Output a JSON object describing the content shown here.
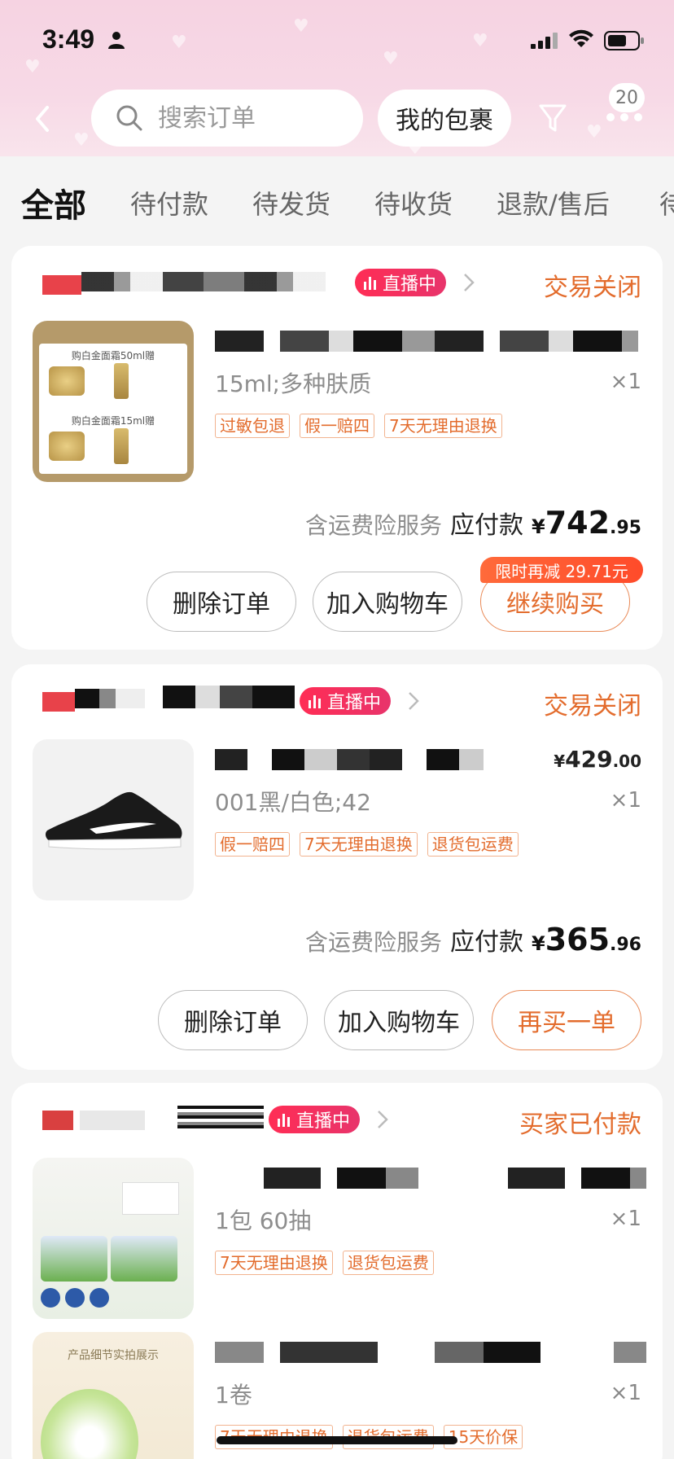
{
  "status_bar": {
    "time": "3:49"
  },
  "nav": {
    "search_placeholder": "搜索订单",
    "package_button": "我的包裹",
    "more_badge": "20"
  },
  "tabs": [
    "全部",
    "待付款",
    "待发货",
    "待收货",
    "退款/售后",
    "待"
  ],
  "orders": [
    {
      "live_label": "直播中",
      "status": "交易关闭",
      "spec": "15ml;多种肤质",
      "qty": "×1",
      "tags": [
        "过敏包退",
        "假一赔四",
        "7天无理由退换"
      ],
      "insurance": "含运费险服务",
      "pay_label": "应付款",
      "currency": "¥",
      "pay_int": "742",
      "pay_dec": ".95",
      "promo": "限时再减 29.71元",
      "buttons": [
        "删除订单",
        "加入购物车",
        "继续购买"
      ],
      "thumb_text": [
        "购白金面霜50ml赠",
        "购白金面霜15ml赠"
      ]
    },
    {
      "live_label": "直播中",
      "status": "交易关闭",
      "price_currency": "¥",
      "price_int": "429",
      "price_dec": ".00",
      "spec": "001黑/白色;42",
      "qty": "×1",
      "tags": [
        "假一赔四",
        "7天无理由退换",
        "退货包运费"
      ],
      "insurance": "含运费险服务",
      "pay_label": "应付款",
      "currency": "¥",
      "pay_int": "365",
      "pay_dec": ".96",
      "buttons": [
        "删除订单",
        "加入购物车",
        "再买一单"
      ]
    },
    {
      "live_label": "直播中",
      "status": "买家已付款",
      "items": [
        {
          "spec": "1包 60抽",
          "qty": "×1",
          "tags": [
            "7天无理由退换",
            "退货包运费"
          ]
        },
        {
          "spec": "1卷",
          "qty": "×1",
          "tags": [
            "7天无理由退换",
            "退货包运费",
            "15天价保"
          ],
          "thumb_text": "产品细节实拍展示"
        }
      ]
    }
  ],
  "colors": {
    "accent": "#e36c2d",
    "live": "#ff2d55",
    "header_bg": "#f6d3e2"
  }
}
